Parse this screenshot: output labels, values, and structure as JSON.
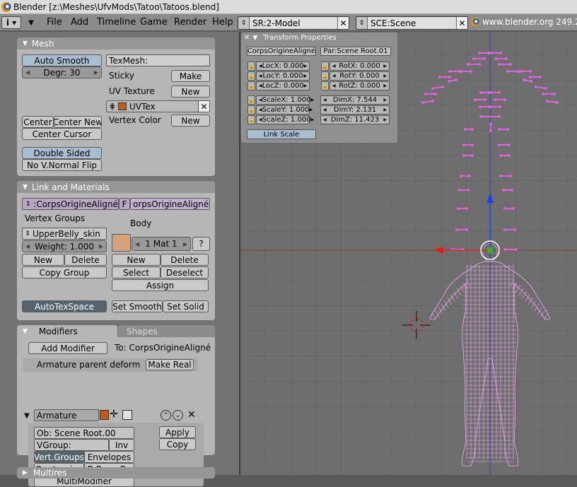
{
  "window": {
    "title": "Blender [z:\\Meshes\\UfvMods\\Tatoo\\Tatoos.blend]"
  },
  "menubar": {
    "items": [
      "File",
      "Add",
      "Timeline",
      "Game",
      "Render",
      "Help"
    ],
    "screen_field": "SR:2-Model",
    "scene_field": "SCE:Scene",
    "url": "www.blender.org 249.2"
  },
  "mesh_panel": {
    "title": "Mesh",
    "auto_smooth": "Auto Smooth",
    "degr": "Degr: 30",
    "texmesh": "TexMesh:",
    "sticky": "Sticky",
    "make": "Make",
    "uv_texture": "UV Texture",
    "new1": "New",
    "uvtex": "UVTex",
    "vertex_color": "Vertex Color",
    "new2": "New",
    "center": "Center",
    "center_new": "Center New",
    "center_cursor": "Center Cursor",
    "double_sided": "Double Sided",
    "no_vnormal_flip": "No V.Normal Flip"
  },
  "link_panel": {
    "title": "Link and Materials",
    "obj_name": ":CorpsOrigineAligné",
    "f": "F",
    "mesh_name": "orpsOrigineAligné",
    "vertex_groups": "Vertex Groups",
    "body": "Body",
    "group_name": "UpperBelly_skin",
    "weight": "Weight: 1.000",
    "mat": "1 Mat 1",
    "question": "?",
    "new_vg": "New",
    "delete_vg": "Delete",
    "copy_group": "Copy Group",
    "new_mat": "New",
    "delete_mat": "Delete",
    "select": "Select",
    "deselect": "Deselect",
    "assign": "Assign",
    "autotexspace": "AutoTexSpace",
    "set_smooth": "Set Smooth",
    "set_solid": "Set Solid",
    "material_color": "#d4a27a"
  },
  "modifiers_panel": {
    "tab_modifiers": "Modifiers",
    "tab_shapes": "Shapes",
    "add_modifier": "Add Modifier",
    "to_label": "To: CorpsOrigineAligné",
    "armature_parent": "Armature parent deform",
    "make_real": "Make Real",
    "mod_name": "Armature",
    "ob_field": "Ob: Scene Root.00",
    "vgroup": "VGroup:",
    "inv": "Inv",
    "vert_groups": "Vert.Groups",
    "envelopes": "Envelopes",
    "quaternion": "Quaternion",
    "bbone": "B-Bone Re",
    "multimodifier": "MultiModifier",
    "apply": "Apply",
    "copy": "Copy"
  },
  "multires_panel": {
    "title": "Multires"
  },
  "transform_props": {
    "title": "Transform Properties",
    "obj": "CorpsOrigineAligné",
    "par": "Par:Scene Root.01",
    "locx": "LocX: 0.000",
    "locy": "LocY: 0.000",
    "locz": "LocZ: 0.000",
    "rotx": "RotX: 0.000",
    "roty": "RotY: 0.000",
    "rotz": "RotZ: 0.000",
    "scalex": "ScaleX: 1.000",
    "scaley": "ScaleY: 1.000",
    "scalez": "ScaleZ: 1.000",
    "dimx": "DimX: 7.544",
    "dimy": "DimY: 2.131",
    "dimz": "DimZ: 11.423",
    "link_scale": "Link Scale"
  },
  "colors": {
    "mesh_wire": "#f4a8f4",
    "bone": "#e060e0",
    "axis_x": "#e02020",
    "axis_z": "#2040e0",
    "origin": "#20c020"
  }
}
